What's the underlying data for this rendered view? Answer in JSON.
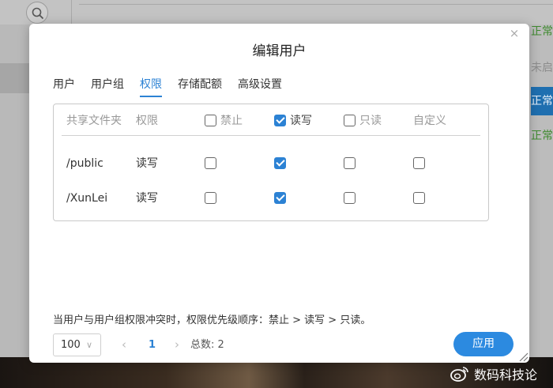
{
  "modal": {
    "title": "编辑用户",
    "close_label": "×",
    "tabs": [
      {
        "label": "用户"
      },
      {
        "label": "用户组"
      },
      {
        "label": "权限",
        "active": true
      },
      {
        "label": "存储配额"
      },
      {
        "label": "高级设置"
      }
    ],
    "table": {
      "headers": {
        "folder": "共享文件夹",
        "permission": "权限",
        "deny": "禁止",
        "read_write": "读写",
        "read_only": "只读",
        "custom": "自定义"
      },
      "header_checks": {
        "deny": false,
        "read_write": true,
        "read_only": false
      },
      "rows": [
        {
          "folder": "/public",
          "permission": "读写",
          "deny": false,
          "read_write": true,
          "read_only": false,
          "custom": false
        },
        {
          "folder": "/XunLei",
          "permission": "读写",
          "deny": false,
          "read_write": true,
          "read_only": false,
          "custom": false
        }
      ]
    },
    "note": "当用户与用户组权限冲突时，权限优先级顺序：禁止 > 读写 > 只读。",
    "pagination": {
      "page_size": "100",
      "prev": "‹",
      "current_page": "1",
      "next": "›",
      "total": "总数: 2"
    },
    "apply_label": "应用"
  },
  "background": {
    "status_items": [
      "正常",
      "未启",
      "正常",
      "正常"
    ]
  },
  "watermark": {
    "text": "数码科技论"
  },
  "colors": {
    "accent": "#2c82d4",
    "button": "#2c8ae0",
    "status_ok": "#3f8a2f"
  },
  "icons": {
    "search": "search-icon",
    "close": "close-icon",
    "check": "check-icon"
  }
}
